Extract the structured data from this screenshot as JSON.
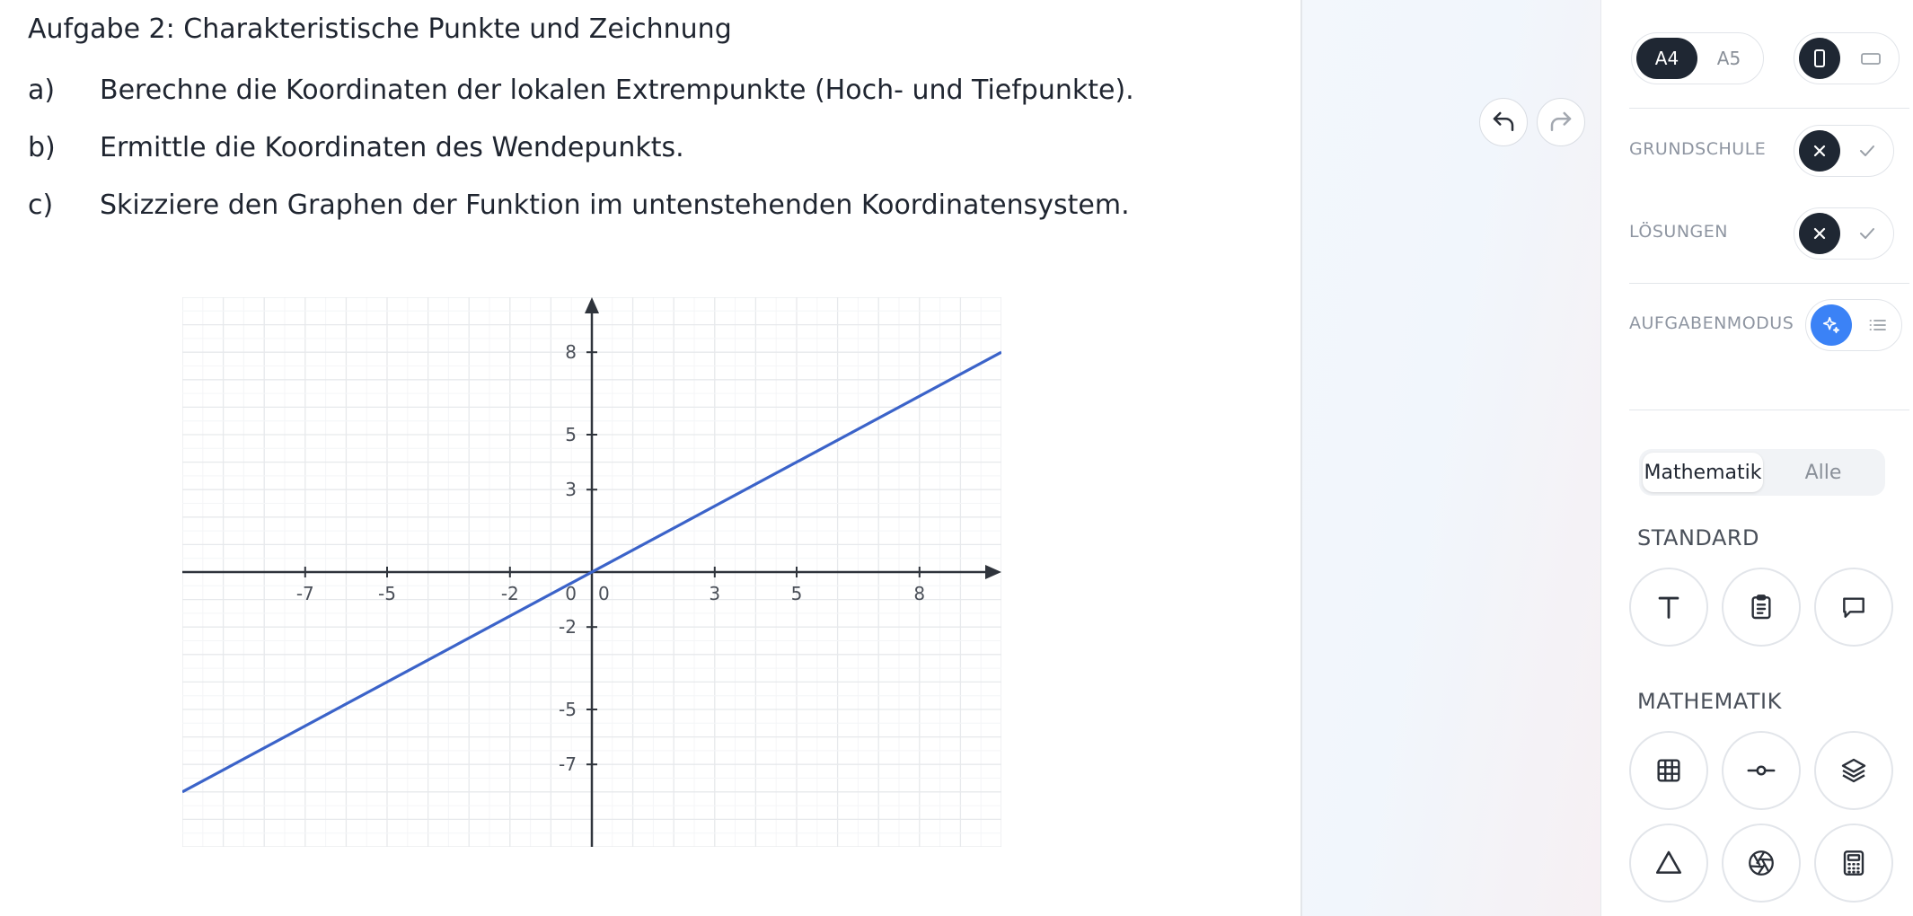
{
  "worksheet": {
    "title": "Aufgabe 2: Charakteristische Punkte und Zeichnung",
    "tasks": [
      {
        "label": "a)",
        "text": "Berechne die Koordinaten der lokalen Extrempunkte (Hoch- und Tiefpunkte)."
      },
      {
        "label": "b)",
        "text": "Ermittle die Koordinaten des Wendepunkts."
      },
      {
        "label": "c)",
        "text": "Skizziere den Graphen der Funktion im untenstehenden Koordinatensystem."
      }
    ]
  },
  "chart_data": {
    "type": "line",
    "xlim": [
      -10,
      10
    ],
    "ylim": [
      -10,
      10
    ],
    "x_ticks": [
      -7,
      -5,
      -2,
      0,
      3,
      5,
      8
    ],
    "y_ticks": [
      8,
      5,
      3,
      0,
      -2,
      -5,
      -7
    ],
    "x_tick_labels": [
      "-7",
      "-5",
      "-2",
      "0",
      "3",
      "5",
      "8"
    ],
    "y_tick_labels": [
      "8",
      "5",
      "3",
      "0",
      "-2",
      "-5",
      "-7"
    ],
    "grid": true,
    "series": [
      {
        "x": [
          -10,
          10
        ],
        "y": [
          -8,
          8
        ],
        "color": "#3b63c9"
      }
    ]
  },
  "canvas_toolbar": {
    "undo_icon": "undo-arrow-icon",
    "redo_icon": "redo-arrow-icon"
  },
  "panel": {
    "paper_sizes": [
      "A4",
      "A5"
    ],
    "paper_size_selected": "A4",
    "orientation_icons": [
      "portrait-icon",
      "landscape-icon"
    ],
    "grundschule_label": "GRUNDSCHULE",
    "loesungen_label": "LÖSUNGEN",
    "aufgabenmodus_label": "AUFGABENMODUS",
    "subject_tabs": [
      "Mathematik",
      "Alle"
    ],
    "standard_heading": "STANDARD",
    "mathematik_heading": "MATHEMATIK",
    "standard_tools": [
      "text-icon",
      "clipboard-icon",
      "speech-bubble-icon"
    ],
    "math_tools": [
      "grid-table-icon",
      "number-line-icon",
      "layers-icon",
      "triangle-icon",
      "aperture-icon",
      "calculator-icon"
    ]
  },
  "colors": {
    "accent_dark": "#1f2733",
    "accent_blue": "#3b82f6",
    "graph_line": "#3b63c9"
  }
}
